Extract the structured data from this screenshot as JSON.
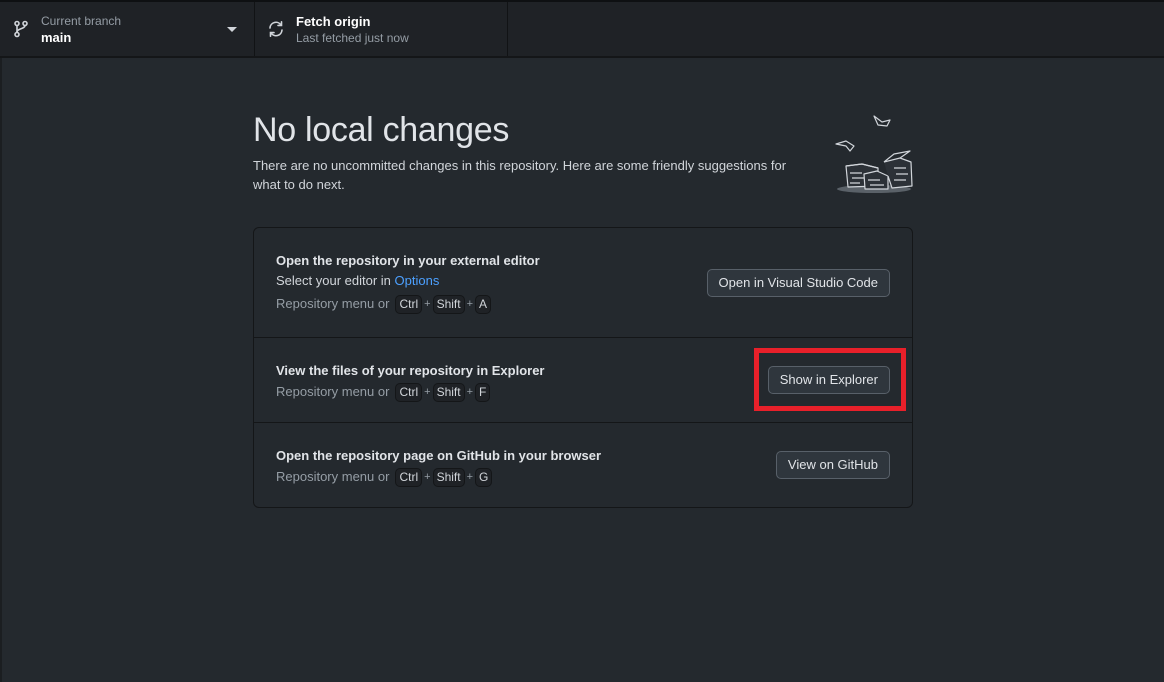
{
  "toolbar": {
    "branch": {
      "label": "Current branch",
      "value": "main",
      "icon": "git-branch-icon"
    },
    "fetch": {
      "label": "Fetch origin",
      "status": "Last fetched just now",
      "icon": "sync-icon"
    }
  },
  "main": {
    "title": "No local changes",
    "subtitle": "There are no uncommitted changes in this repository. Here are some friendly suggestions for what to do next.",
    "illustration": "paper-stack-illustration"
  },
  "suggestions": [
    {
      "title": "Open the repository in your external editor",
      "desc_prefix": "Select your editor in ",
      "desc_link": "Options",
      "shortcut_prefix": "Repository menu or",
      "keys": [
        "Ctrl",
        "Shift",
        "A"
      ],
      "button": "Open in Visual Studio Code"
    },
    {
      "title": "View the files of your repository in Explorer",
      "shortcut_prefix": "Repository menu or",
      "keys": [
        "Ctrl",
        "Shift",
        "F"
      ],
      "button": "Show in Explorer"
    },
    {
      "title": "Open the repository page on GitHub in your browser",
      "shortcut_prefix": "Repository menu or",
      "keys": [
        "Ctrl",
        "Shift",
        "G"
      ],
      "button": "View on GitHub"
    }
  ],
  "plus_sign": "+",
  "colors": {
    "background": "#24292e",
    "toolbar": "#1f2226",
    "link": "#4ca0ff",
    "highlight": "#e8202a"
  }
}
